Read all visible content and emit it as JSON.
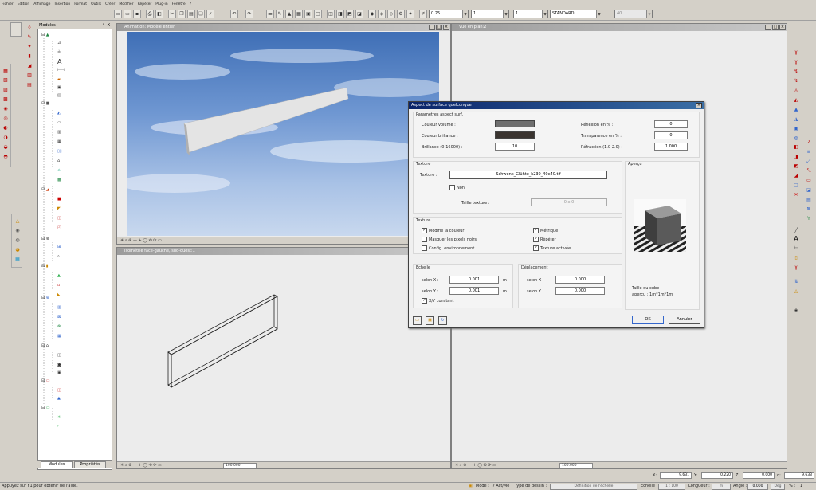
{
  "menu": [
    "Fichier",
    "Edition",
    "Affichage",
    "Insertion",
    "Format",
    "Outils",
    "Créer",
    "Modifier",
    "Répéter",
    "Plug-in",
    "Fenêtre",
    "?"
  ],
  "toolbar": {
    "line_width": "0.25",
    "line_type": "1",
    "pen": "1",
    "layer": "STANDARD",
    "zoom_value": "40"
  },
  "modules": {
    "header": "Modules",
    "close": "X",
    "tab_modules": "Modules",
    "tab_props": "Propriétés"
  },
  "windows": {
    "anim": {
      "title": "Animation: Modèle entier"
    },
    "plan": {
      "title": "Vue en plan:2"
    },
    "iso": {
      "title": "Isométrie face-gauche, sud-ouest:1",
      "zoom": "100.000"
    },
    "plan_zoom": "100.000"
  },
  "dialog": {
    "title": "Aspect de surface quelconque",
    "params_group": "Paramètres aspect surf.",
    "couleur_volume": "Couleur volume :",
    "couleur_brillance": "Couleur brillance :",
    "brillance": "Brillance (0-16000) :",
    "brillance_value": "10",
    "reflexion": "Réflexion en % :",
    "reflexion_value": "0",
    "transparence": "Transparence en % :",
    "transparence_value": "0",
    "refraction": "Réfraction (1.0-2.0) :",
    "refraction_value": "1.000",
    "texture_group": "Texture",
    "texture_label": "Texture :",
    "texture_file": "Schwenk_Glühte_k230_40x40.tif",
    "non": "Non",
    "taille_texture": "Taille texture :",
    "taille_value": "0 x 0",
    "apercu": "Aperçu",
    "texture_group2": "Texture",
    "modifie_couleur": "Modifie la couleur",
    "masquer_pixels": "Masquer les pixels noirs",
    "config_env": "Config. environnement",
    "metrique": "Métrique",
    "repeter": "Répéter",
    "texture_activee": "Texture activée",
    "echelle": "Echelle",
    "selon_x": "selon X :",
    "selon_y": "selon Y :",
    "echelle_x": "0.001",
    "echelle_y": "0.001",
    "unit": "m",
    "xy_constant": "X/Y constant",
    "deplacement": "Déplacement",
    "dep_x_label": "selon X :",
    "dep_y_label": "selon Y :",
    "dep_x": "0.000",
    "dep_y": "0.000",
    "taille_cube": "Taille du cube",
    "apercu_size": "aperçu : 1m*1m*1m",
    "ok": "OK",
    "annuler": "Annuler",
    "volume_color": "#6e6e6e",
    "brillance_color": "#3a3430"
  },
  "coords": {
    "x_label": "X:",
    "x": "9.631",
    "y_label": "Y:",
    "y": "0.220",
    "z_label": "Z:",
    "z": "0.000",
    "d_label": "d:",
    "d": "9.633"
  },
  "status": {
    "hint": "Appuyez sur F1 pour obtenir de l'aide.",
    "mode": "Mode :",
    "mode_value": "? Act/Me",
    "type_dessin": "Type de dessin :",
    "type_value": "Définition de l'échelle",
    "echelle": "Echelle :",
    "echelle_value": "1 : 100",
    "longueur": "Longueur :",
    "longueur_value": "m",
    "angle": "Angle :",
    "angle_value": "0.000",
    "angle_unit": "Deg",
    "pct": "% :",
    "pct_value": "1"
  }
}
